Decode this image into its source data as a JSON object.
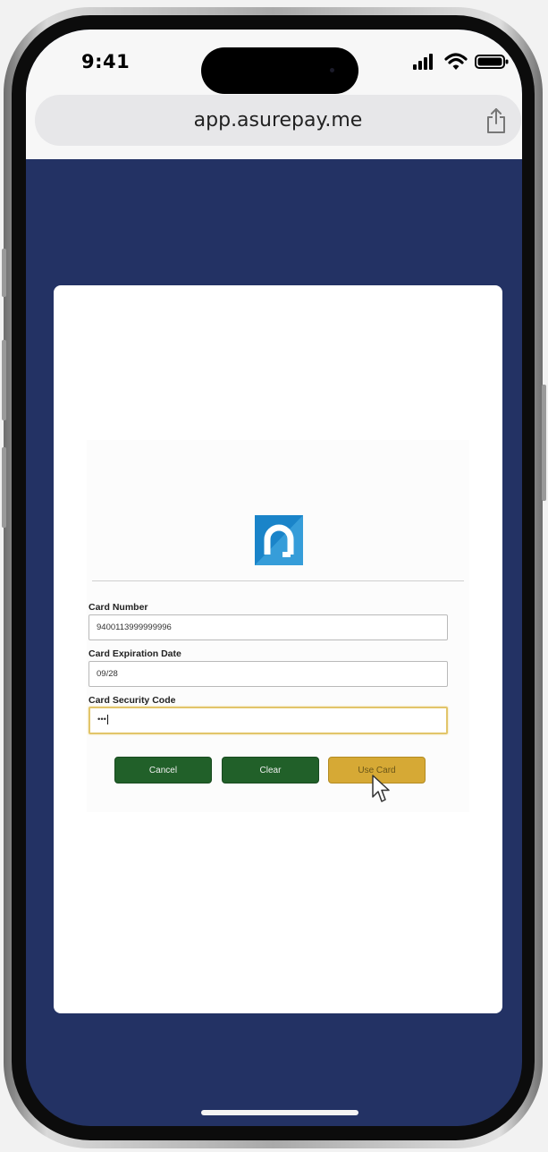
{
  "status_bar": {
    "time": "9:41"
  },
  "browser": {
    "url": "app.asurepay.me"
  },
  "form": {
    "card_number": {
      "label": "Card Number",
      "value": "9400113999999996"
    },
    "expiration": {
      "label": "Card Expiration Date",
      "value": "09/28"
    },
    "security_code": {
      "label": "Card Security Code",
      "value": "•••"
    },
    "buttons": {
      "cancel": "Cancel",
      "clear": "Clear",
      "use_card": "Use Card"
    }
  },
  "colors": {
    "page_background": "#233264",
    "button_green": "#216029",
    "button_gold": "#d6a935",
    "logo_blue": "#1a84c9"
  },
  "icons": [
    "signal-icon",
    "wifi-icon",
    "battery-icon",
    "share-icon",
    "asurepay-logo",
    "mouse-cursor-icon"
  ]
}
